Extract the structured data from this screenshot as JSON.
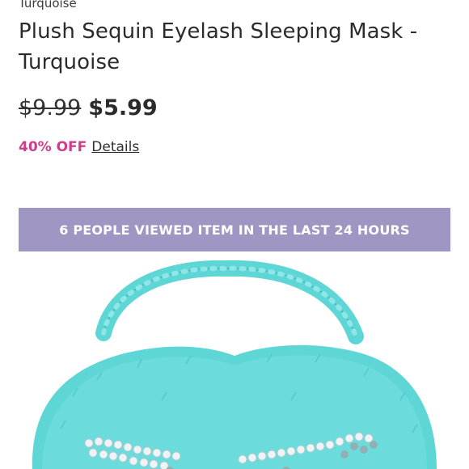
{
  "breadcrumb": {
    "label": "Turquoise"
  },
  "product": {
    "title": "Plush Sequin Eyelash Sleeping Mask - Turquoise",
    "price_original": "$9.99",
    "price_sale": "$5.99",
    "discount_label": "40% OFF",
    "details_link": "Details"
  },
  "banner": {
    "text": "6 PEOPLE VIEWED ITEM IN THE LAST 24 HOURS"
  },
  "colors": {
    "discount": "#d23a8e",
    "banner_bg": "#a096c3",
    "mask": "#5fd6d6",
    "sequin": "#eef4f5"
  },
  "image": {
    "icon": "sleeping-mask-product-image"
  }
}
